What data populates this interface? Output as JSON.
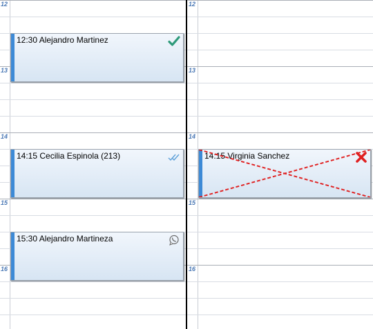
{
  "hours": [
    "12",
    "13",
    "14",
    "15",
    "16"
  ],
  "columns": [
    {
      "id": "left",
      "appointments": [
        {
          "title": "12:30 Alejandro Martinez",
          "status_icon": "checkmark-icon",
          "status_color": "#2e9a7a"
        },
        {
          "title": "14:15 Cecilia Espinola (213)",
          "status_icon": "double-check-icon",
          "status_color": "#5a9fd8"
        },
        {
          "title": "15:30 Alejandro Martineza",
          "status_icon": "whatsapp-icon",
          "status_color": "#6b6b6b"
        }
      ]
    },
    {
      "id": "right",
      "appointments": [
        {
          "title": "14:15 Virginia Sanchez",
          "status_icon": "cancel-x-icon",
          "status_color": "#e02020",
          "cancelled": true
        }
      ]
    }
  ]
}
